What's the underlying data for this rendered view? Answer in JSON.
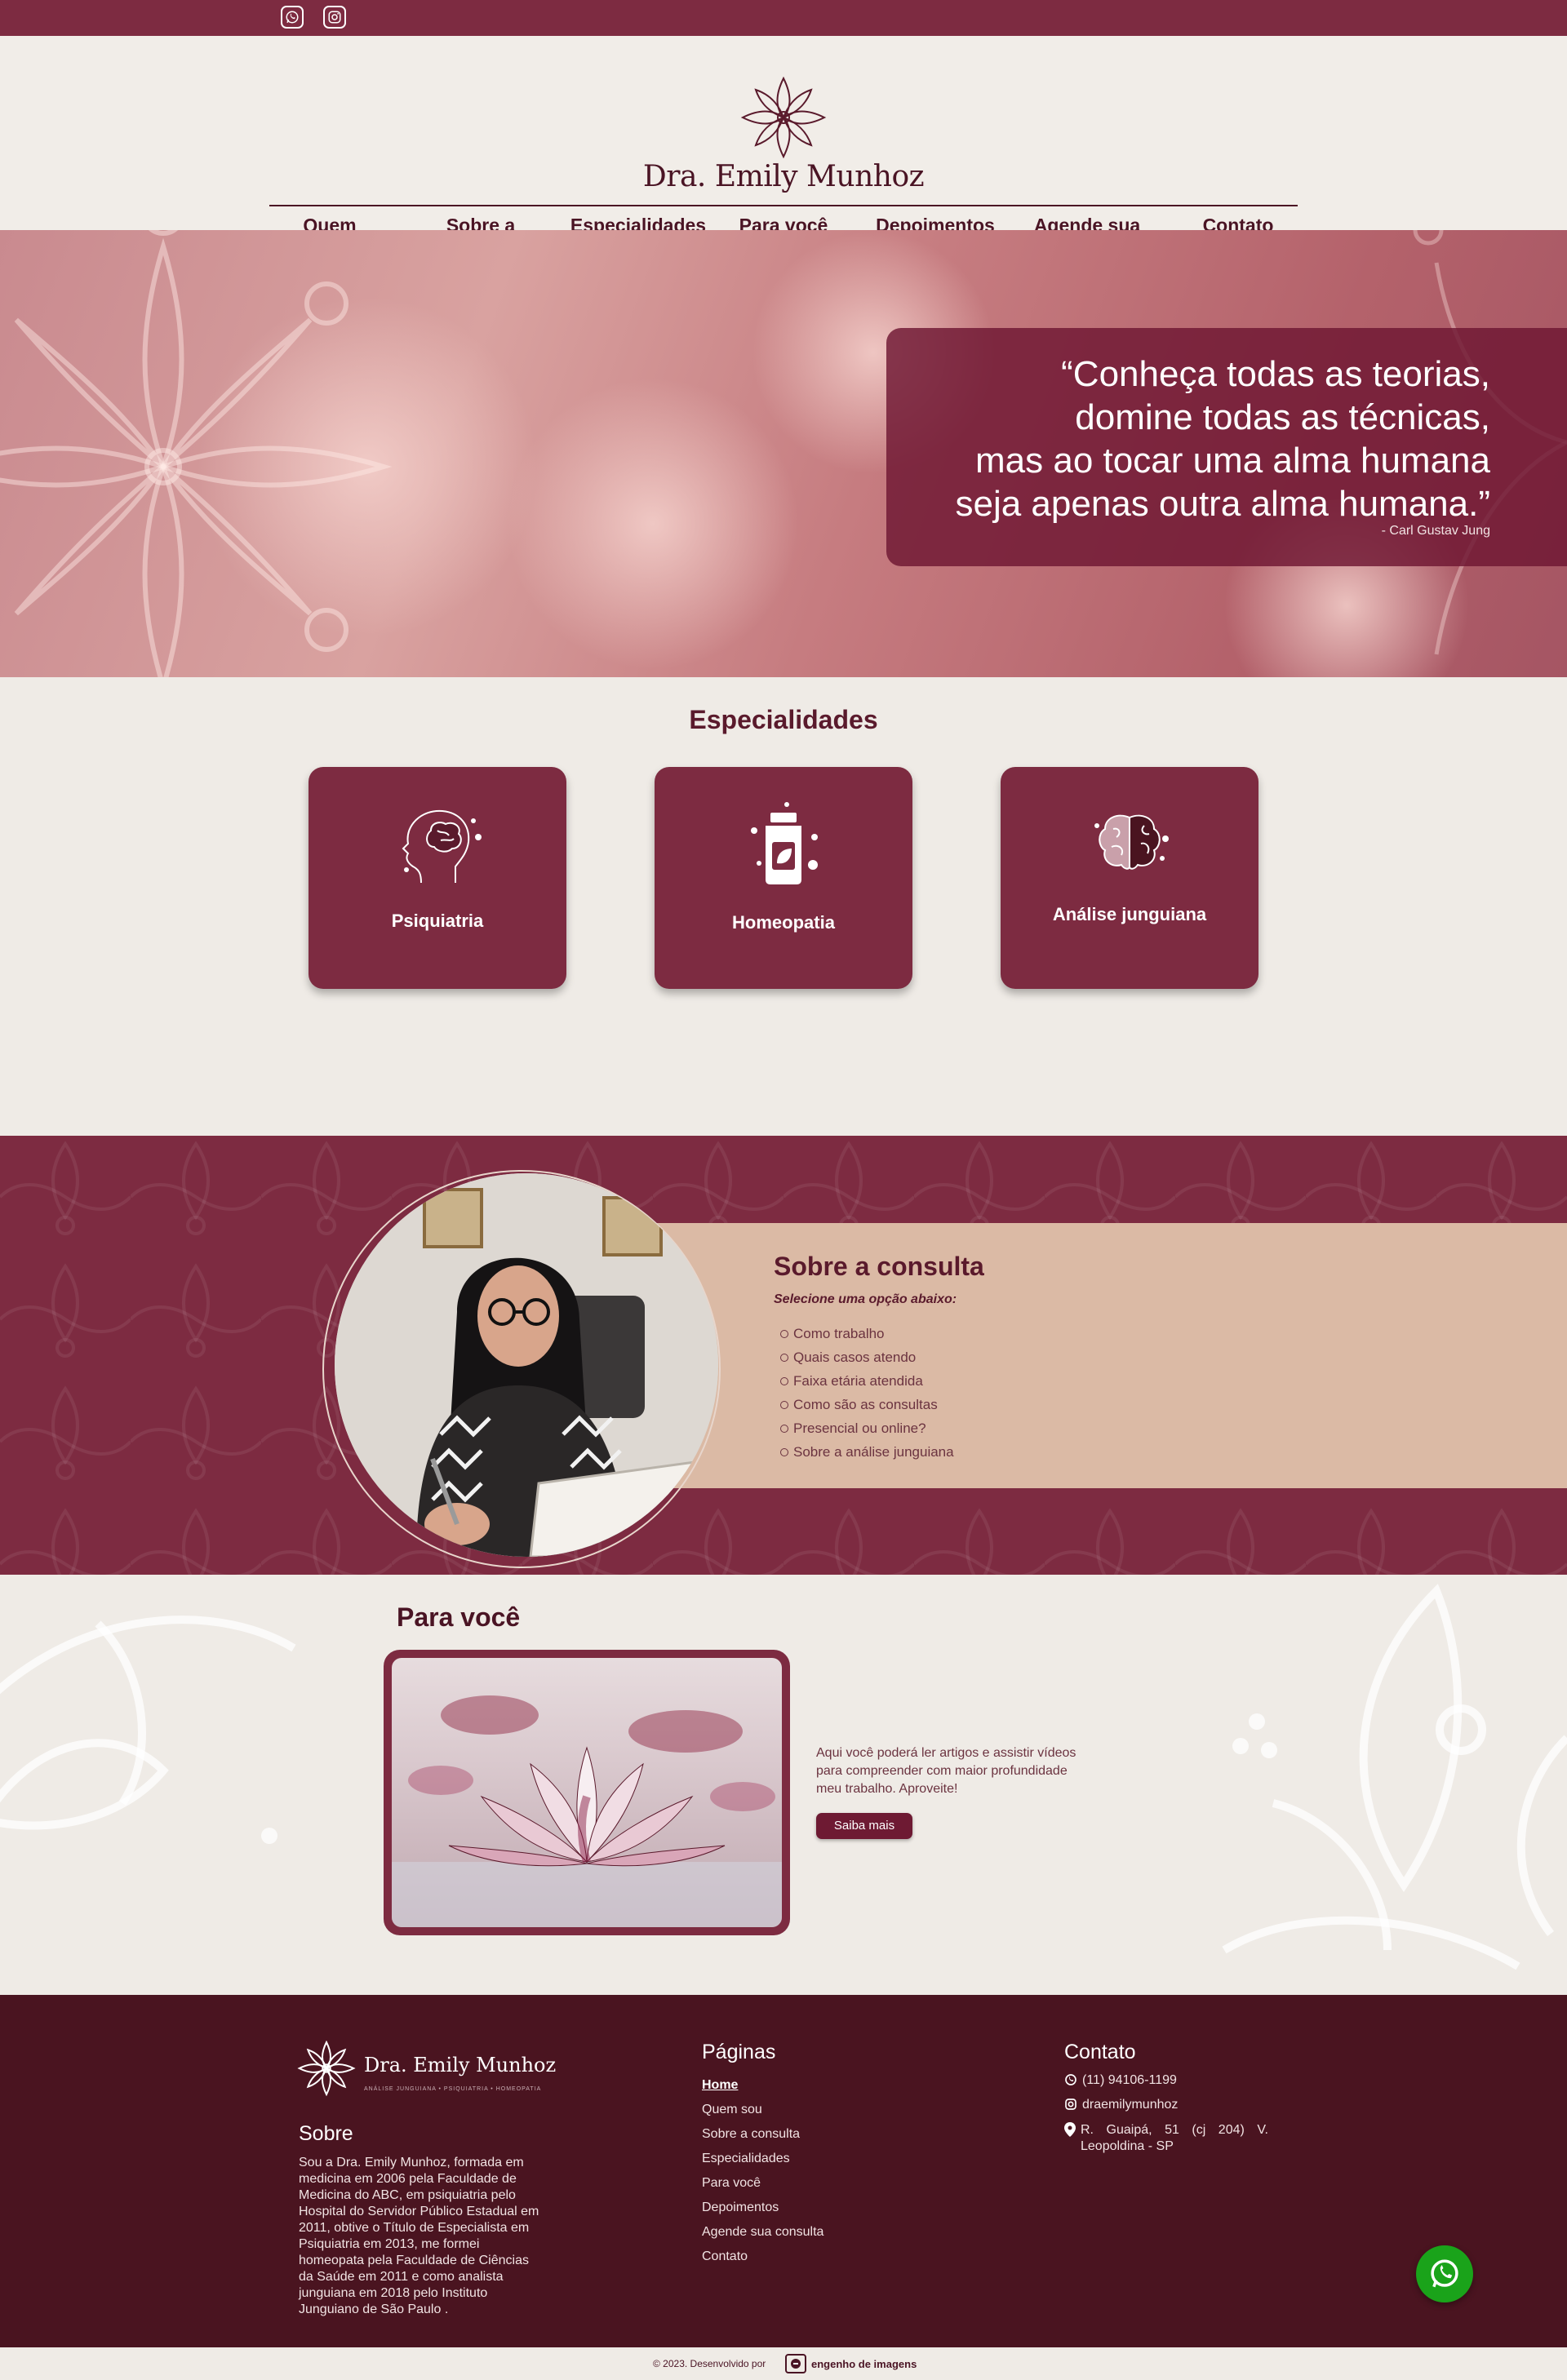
{
  "topbar": {
    "icons": [
      "whatsapp-icon",
      "instagram-icon"
    ]
  },
  "header": {
    "logo_text": "Dra. Emily Munhoz"
  },
  "nav": [
    {
      "label": "Quem sou"
    },
    {
      "label": "Sobre a consulta"
    },
    {
      "label": "Especialidades"
    },
    {
      "label": "Para você"
    },
    {
      "label": "Depoimentos"
    },
    {
      "label": "Agende sua consulta"
    },
    {
      "label": "Contato"
    }
  ],
  "hero": {
    "quote_line1": "“Conheça todas as teorias,",
    "quote_line2": "domine todas as técnicas,",
    "quote_line3": "mas ao tocar uma alma humana",
    "quote_line4": "seja apenas outra alma humana.”",
    "author": "- Carl Gustav Jung"
  },
  "specialties": {
    "title": "Especialidades",
    "items": [
      {
        "label": "Psiquiatria",
        "icon": "head-brain-icon"
      },
      {
        "label": "Homeopatia",
        "icon": "remedy-bottle-icon"
      },
      {
        "label": "Análise junguiana",
        "icon": "brain-icon"
      }
    ]
  },
  "consulta": {
    "title": "Sobre a consulta",
    "subtitle": "Selecione uma opção abaixo:",
    "options": [
      "Como trabalho",
      "Quais casos atendo",
      "Faixa etária atendida",
      "Como são as consultas",
      "Presencial ou online?",
      "Sobre a análise junguiana"
    ]
  },
  "para_voce": {
    "title": "Para você",
    "text": "Aqui você poderá ler artigos e assistir vídeos para compreender com maior profundidade meu trabalho. Aproveite!",
    "button": "Saiba mais"
  },
  "footer": {
    "logo_text": "Dra. Emily Munhoz",
    "logo_tag": "ANÁLISE JUNGUIANA • PSIQUIATRIA • HOMEOPATIA",
    "about_title": "Sobre",
    "about_text": "Sou a Dra. Emily Munhoz, formada em medicina em 2006 pela Faculdade de Medicina do ABC, em psiquiatria pelo Hospital do Servidor Público Estadual em 2011, obtive o Título de Especialista em Psiquiatria em 2013, me formei homeopata pela Faculdade de Ciências da Saúde em 2011 e como analista junguiana em 2018 pelo Instituto Junguiano de São Paulo .",
    "pages_title": "Páginas",
    "pages": [
      "Home",
      "Quem sou",
      "Sobre a consulta",
      "Especialidades",
      "Para você",
      "Depoimentos",
      "Agende sua consulta",
      "Contato"
    ],
    "contact_title": "Contato",
    "phone": "(11) 94106-1199",
    "instagram": "draemilymunhoz",
    "address": "R. Guaipá, 51 (cj 204) V. Leopoldina - SP"
  },
  "bottom": {
    "credit": "© 2023. Desenvolvido por",
    "brand": "engenho de imagens"
  },
  "colors": {
    "primary": "#7d2b41",
    "dark": "#4a1420",
    "beige": "#dbbaa5",
    "whatsapp": "#1aa31a"
  }
}
